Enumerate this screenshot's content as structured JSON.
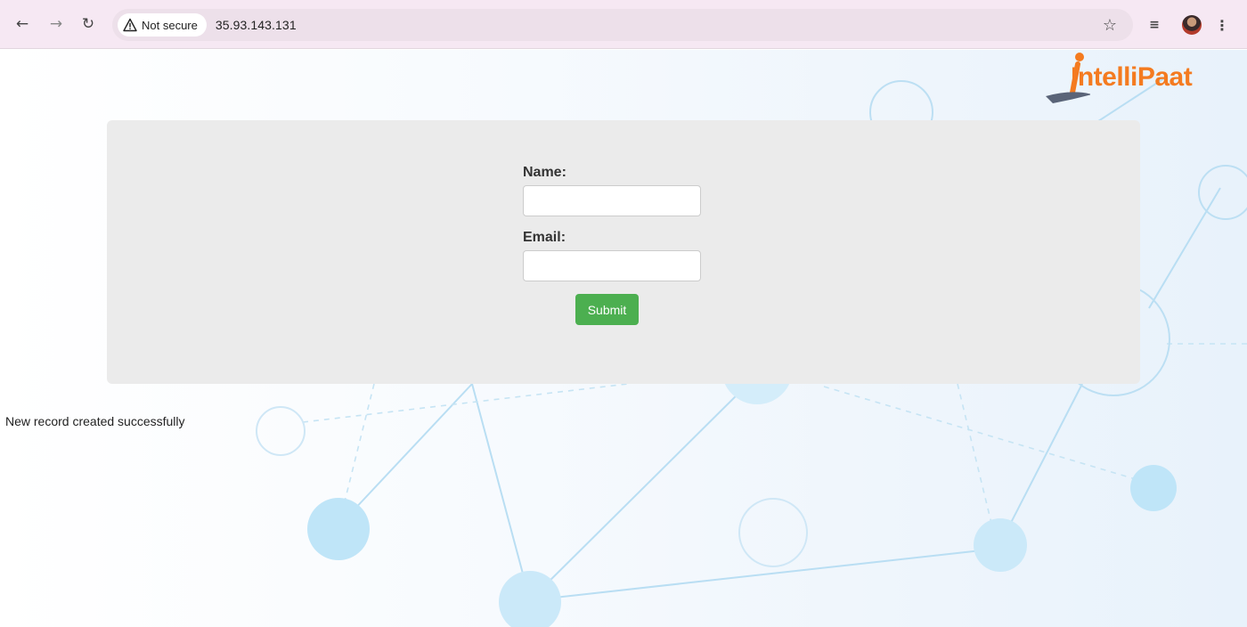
{
  "browser": {
    "security_label": "Not secure",
    "url": "35.93.143.131"
  },
  "brand": {
    "logo_part1": "I",
    "logo_part2": "ntelli",
    "logo_part3": "Paat"
  },
  "form": {
    "name_label": "Name:",
    "name_value": "",
    "email_label": "Email:",
    "email_value": "",
    "submit_label": "Submit"
  },
  "status": {
    "message": "New record created successfully"
  },
  "colors": {
    "submit_bg": "#4caf50",
    "panel_bg": "#ebebeb",
    "brand_orange": "#f47b20",
    "brand_gray": "#5a6478"
  }
}
